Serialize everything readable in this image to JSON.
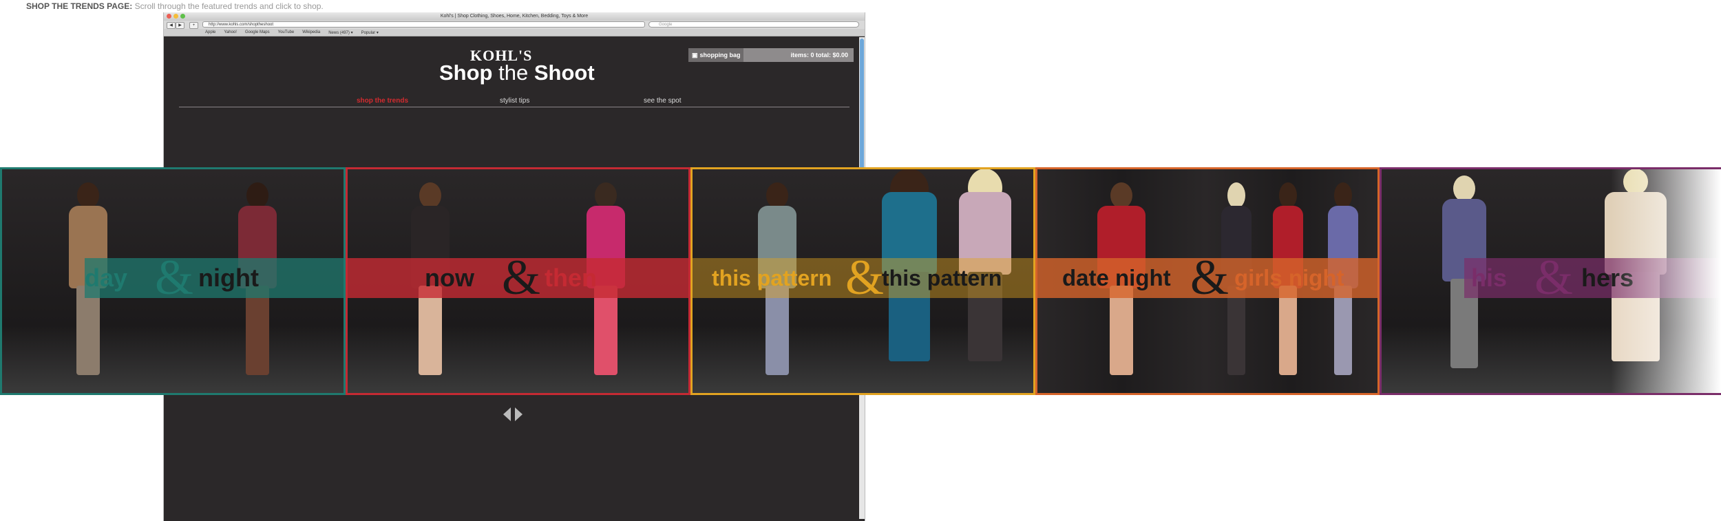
{
  "caption": {
    "title": "SHOP THE TRENDS PAGE:",
    "text": " Scroll through the featured trends and click to shop."
  },
  "browser": {
    "window_title": "Kohl's | Shop Clothing, Shoes, Home, Kitchen, Bedding, Toys & More",
    "url": "http://www.kohls.com/shoptheshoot",
    "search_placeholder": "Google",
    "bookmarks": [
      "Apple",
      "Yahoo!",
      "Google Maps",
      "YouTube",
      "Wikipedia",
      "News (497) ▾",
      "Popular ▾"
    ]
  },
  "header": {
    "logo": "KOHL'S",
    "title_shop": "Shop ",
    "title_the": "the",
    "title_shoot": " Shoot",
    "bag_label": "shopping bag",
    "bag_status": "items: 0 total: $0.00"
  },
  "tabs": [
    "shop the trends",
    "stylist tips",
    "see the spot"
  ],
  "trends": [
    {
      "left": "day",
      "right": "night",
      "color": "#1f7a6f"
    },
    {
      "left": "now",
      "right": "then",
      "color": "#c52a33"
    },
    {
      "left": "this pattern",
      "right": "this pattern",
      "color": "#e2a321"
    },
    {
      "left": "date night",
      "right": "girls night",
      "color": "#d6642a"
    },
    {
      "left": "his",
      "right": "hers",
      "color": "#7a2d69"
    }
  ],
  "amp": "&",
  "colors": {
    "page_bg": "#2b2829",
    "accent_red": "#d32b2f",
    "browser_chrome": "#d9d9d9"
  }
}
